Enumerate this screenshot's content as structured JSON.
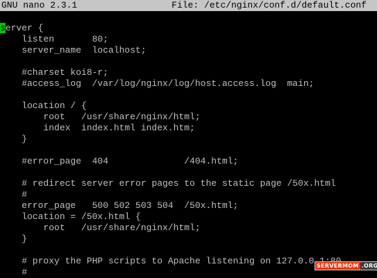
{
  "titlebar": {
    "app": "GNU nano 2.3.1",
    "file": "File: /etc/nginx/conf.d/default.conf"
  },
  "editor": {
    "cursor_char": "s",
    "first_line_rest": "erver {",
    "lines": [
      "    listen       80;",
      "    server_name  localhost;",
      "",
      "    #charset koi8-r;",
      "    #access_log  /var/log/nginx/log/host.access.log  main;",
      "",
      "    location / {",
      "        root   /usr/share/nginx/html;",
      "        index  index.html index.htm;",
      "    }",
      "",
      "    #error_page  404              /404.html;",
      "",
      "    # redirect server error pages to the static page /50x.html",
      "    #",
      "    error_page   500 502 503 504  /50x.html;",
      "    location = /50x.html {",
      "        root   /usr/share/nginx/html;",
      "    }",
      "",
      "    # proxy the PHP scripts to Apache listening on 127.0.0.1:80",
      "    #"
    ]
  },
  "watermark": {
    "part1": "SERVERMOM",
    "part2": ".ORG"
  },
  "colors": {
    "background": "#000000",
    "text": "#c0c0c0",
    "titlebar_bg": "#c6c6c6",
    "cursor": "#00c800"
  }
}
